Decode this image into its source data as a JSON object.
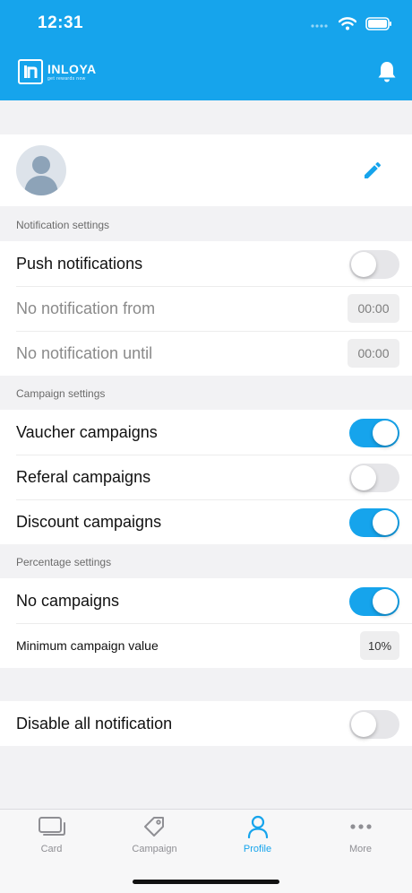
{
  "status_bar": {
    "time": "12:31"
  },
  "app": {
    "logo_name": "INLOYA",
    "logo_tagline": "get rewards now",
    "accent_color": "#16a4ec"
  },
  "sections": {
    "notification": {
      "label": "Notification settings",
      "push": {
        "label": "Push notifications",
        "on": false
      },
      "from": {
        "label": "No notification from",
        "value": "00:00"
      },
      "until": {
        "label": "No notification until",
        "value": "00:00"
      }
    },
    "campaign": {
      "label": "Campaign settings",
      "vaucher": {
        "label": "Vaucher campaigns",
        "on": true
      },
      "referal": {
        "label": "Referal campaigns",
        "on": false
      },
      "discount": {
        "label": "Discount campaigns",
        "on": true
      }
    },
    "percentage": {
      "label": "Percentage settings",
      "no_campaigns": {
        "label": "No campaigns",
        "on": true
      },
      "minimum": {
        "label": "Minimum campaign value",
        "value": "10%"
      }
    },
    "disable_all": {
      "label": "Disable all notification",
      "on": false
    }
  },
  "tabs": [
    {
      "label": "Card",
      "icon": "card-icon",
      "active": false
    },
    {
      "label": "Campaign",
      "icon": "tag-icon",
      "active": false
    },
    {
      "label": "Profile",
      "icon": "person-icon",
      "active": true
    },
    {
      "label": "More",
      "icon": "more-icon",
      "active": false
    }
  ]
}
